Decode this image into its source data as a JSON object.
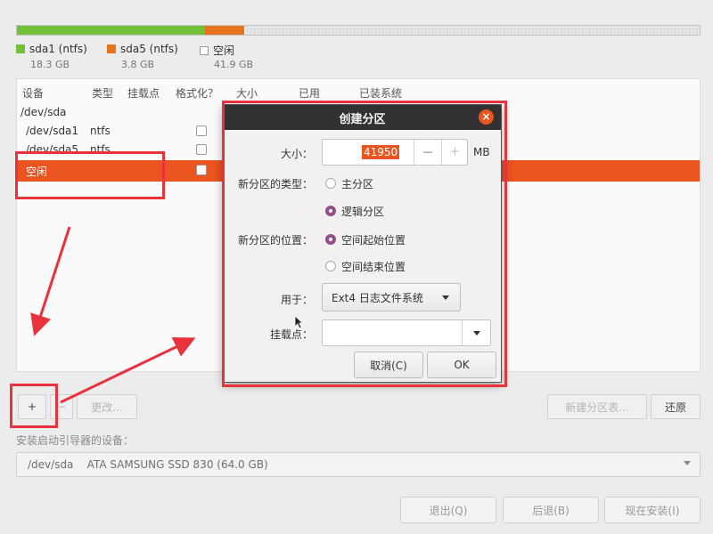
{
  "partition_bar": {
    "segments": [
      {
        "name": "sda1",
        "fraction": 0.275,
        "color": "#73c13a"
      },
      {
        "name": "sda5",
        "fraction": 0.058,
        "color": "#e8731d"
      },
      {
        "name": "free",
        "fraction": 0.667,
        "color": "#dcdcdc"
      }
    ]
  },
  "legend": [
    {
      "label": "sda1 (ntfs)",
      "size": "18.3 GB",
      "color": "#73c13a"
    },
    {
      "label": "sda5 (ntfs)",
      "size": "3.8 GB",
      "color": "#e8731d"
    },
    {
      "label": "空闲",
      "size": "41.9 GB",
      "color": "#ffffff"
    }
  ],
  "table": {
    "headers": [
      "设备",
      "类型",
      "挂载点",
      "格式化？",
      "大小",
      "已用",
      "已装系统"
    ],
    "rows": [
      {
        "device": "/dev/sda",
        "type": ""
      },
      {
        "device": "/dev/sda1",
        "type": "ntfs"
      },
      {
        "device": "/dev/sda5",
        "type": "ntfs"
      },
      {
        "device": "空闲",
        "type": ""
      }
    ]
  },
  "toolbar": {
    "add": "+",
    "remove": "−",
    "change": "更改...",
    "new_table": "新建分区表...",
    "revert": "还原"
  },
  "boot": {
    "label": "安装启动引导器的设备：",
    "value": "/dev/sda    ATA SAMSUNG SSD 830 (64.0 GB)"
  },
  "bottom_buttons": {
    "quit": "退出(Q)",
    "back": "后退(B)",
    "install": "现在安装(I)"
  },
  "dialog": {
    "title": "创建分区",
    "size_label": "大小：",
    "size_value": "41950",
    "size_unit": "MB",
    "minus": "—",
    "plus": "+",
    "type_label": "新分区的类型：",
    "type_primary": "主分区",
    "type_logical": "逻辑分区",
    "location_label": "新分区的位置：",
    "location_start": "空间起始位置",
    "location_end": "空间结束位置",
    "use_label": "用于：",
    "use_value": "Ext4 日志文件系统",
    "mount_label": "挂载点：",
    "mount_value": "",
    "cancel": "取消(C)",
    "ok": "OK"
  },
  "colors": {
    "accent": "#e95420",
    "radio": "#924d8b",
    "annotation": "#e8333d"
  }
}
